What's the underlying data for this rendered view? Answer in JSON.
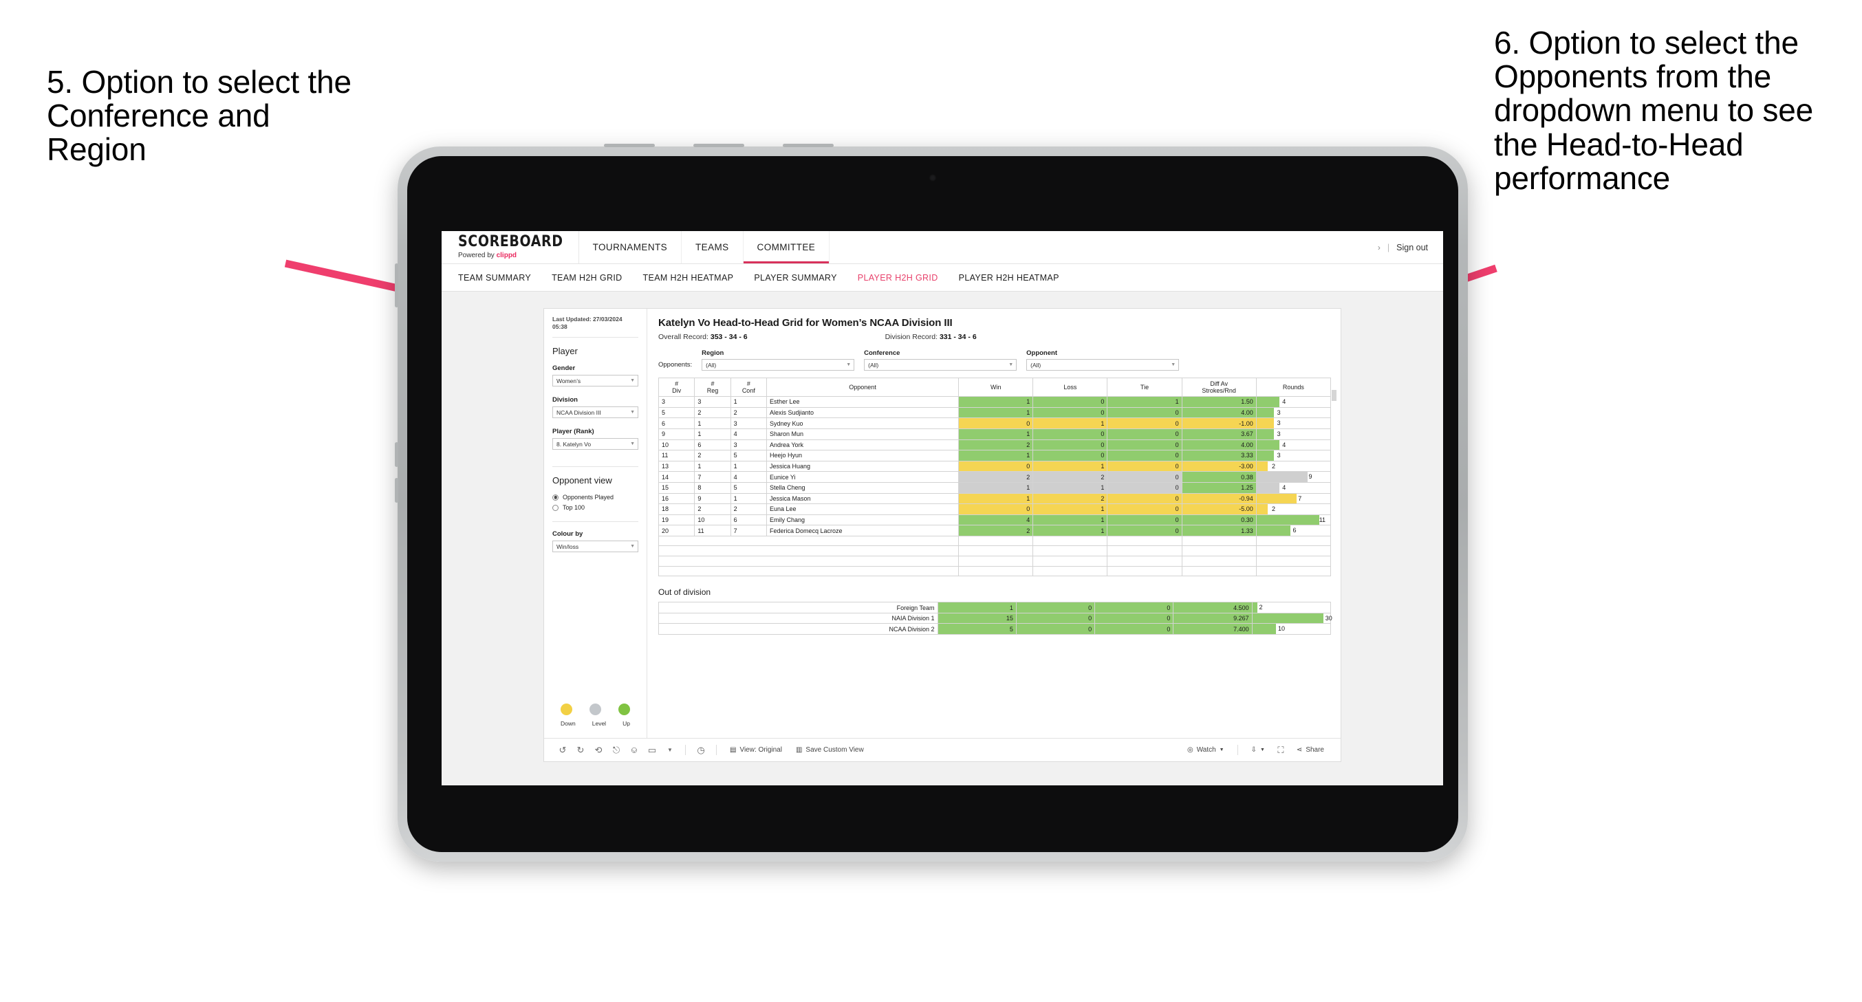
{
  "annotations": {
    "left": "5. Option to select the Conference and Region",
    "right": "6. Option to select the Opponents from the dropdown menu to see the Head-to-Head performance",
    "arrow_color": "#ef3e6d"
  },
  "app": {
    "brand": {
      "name": "SCOREBOARD",
      "powered_prefix": "Powered by",
      "powered_brand": "clippd"
    },
    "topnav": [
      {
        "label": "TOURNAMENTS",
        "active": false
      },
      {
        "label": "TEAMS",
        "active": false
      },
      {
        "label": "COMMITTEE",
        "active": true
      }
    ],
    "top_right": {
      "chevron": "›",
      "divider": "|",
      "sign_out": "Sign out"
    },
    "subnav": [
      {
        "label": "TEAM SUMMARY",
        "active": false
      },
      {
        "label": "TEAM H2H GRID",
        "active": false
      },
      {
        "label": "TEAM H2H HEATMAP",
        "active": false
      },
      {
        "label": "PLAYER SUMMARY",
        "active": false
      },
      {
        "label": "PLAYER H2H GRID",
        "active": true
      },
      {
        "label": "PLAYER H2H HEATMAP",
        "active": false
      }
    ]
  },
  "sidebar": {
    "last_updated": "Last Updated: 27/03/2024 05:38",
    "player_section": "Player",
    "gender": {
      "label": "Gender",
      "value": "Women’s"
    },
    "division": {
      "label": "Division",
      "value": "NCAA Division III"
    },
    "player_rank": {
      "label": "Player (Rank)",
      "value": "8. Katelyn Vo"
    },
    "opponent_view": {
      "title": "Opponent view",
      "options": [
        {
          "label": "Opponents Played",
          "selected": true
        },
        {
          "label": "Top 100",
          "selected": false
        }
      ]
    },
    "colour_by": {
      "label": "Colour by",
      "value": "Win/loss"
    },
    "legend": [
      {
        "label": "Down",
        "color": "#f2d044"
      },
      {
        "label": "Level",
        "color": "#c3c7cb"
      },
      {
        "label": "Up",
        "color": "#80c342"
      }
    ]
  },
  "main": {
    "title": "Katelyn Vo Head-to-Head Grid for Women’s NCAA Division III",
    "overall_record_label": "Overall Record:",
    "overall_record_value": "353 - 34 - 6",
    "division_record_label": "Division Record:",
    "division_record_value": "331 - 34 - 6",
    "opponents_label": "Opponents:",
    "filters": [
      {
        "label": "Region",
        "value": "(All)"
      },
      {
        "label": "Conference",
        "value": "(All)"
      },
      {
        "label": "Opponent",
        "value": "(All)"
      }
    ],
    "out_of_division_title": "Out of division"
  },
  "chart_data": {
    "type": "table",
    "title": "Katelyn Vo Head-to-Head Grid for Women’s NCAA Division III",
    "columns": [
      "# Div",
      "# Reg",
      "# Conf",
      "Opponent",
      "Win",
      "Loss",
      "Tie",
      "Diff Av Strokes/Rnd",
      "Rounds"
    ],
    "column_headers_multiline": [
      [
        "#",
        "Div"
      ],
      [
        "#",
        "Reg"
      ],
      [
        "#",
        "Conf"
      ],
      [
        "Opponent"
      ],
      [
        "Win"
      ],
      [
        "Loss"
      ],
      [
        "Tie"
      ],
      [
        "Diff Av",
        "Strokes/Rnd"
      ],
      [
        "Rounds"
      ]
    ],
    "rows": [
      {
        "div": "3",
        "reg": "3",
        "conf": "1",
        "opponent": "Esther Lee",
        "win": "1",
        "loss": "0",
        "tie": "1",
        "diff": "1.50",
        "rounds": 4,
        "result": "up"
      },
      {
        "div": "5",
        "reg": "2",
        "conf": "2",
        "opponent": "Alexis Sudjianto",
        "win": "1",
        "loss": "0",
        "tie": "0",
        "diff": "4.00",
        "rounds": 3,
        "result": "up"
      },
      {
        "div": "6",
        "reg": "1",
        "conf": "3",
        "opponent": "Sydney Kuo",
        "win": "0",
        "loss": "1",
        "tie": "0",
        "diff": "-1.00",
        "rounds": 3,
        "result": "down"
      },
      {
        "div": "9",
        "reg": "1",
        "conf": "4",
        "opponent": "Sharon Mun",
        "win": "1",
        "loss": "0",
        "tie": "0",
        "diff": "3.67",
        "rounds": 3,
        "result": "up"
      },
      {
        "div": "10",
        "reg": "6",
        "conf": "3",
        "opponent": "Andrea York",
        "win": "2",
        "loss": "0",
        "tie": "0",
        "diff": "4.00",
        "rounds": 4,
        "result": "up"
      },
      {
        "div": "11",
        "reg": "2",
        "conf": "5",
        "opponent": "Heejo Hyun",
        "win": "1",
        "loss": "0",
        "tie": "0",
        "diff": "3.33",
        "rounds": 3,
        "result": "up"
      },
      {
        "div": "13",
        "reg": "1",
        "conf": "1",
        "opponent": "Jessica Huang",
        "win": "0",
        "loss": "1",
        "tie": "0",
        "diff": "-3.00",
        "rounds": 2,
        "result": "down"
      },
      {
        "div": "14",
        "reg": "7",
        "conf": "4",
        "opponent": "Eunice Yi",
        "win": "2",
        "loss": "2",
        "tie": "0",
        "diff": "0.38",
        "rounds": 9,
        "result": "level",
        "diff_result": "up"
      },
      {
        "div": "15",
        "reg": "8",
        "conf": "5",
        "opponent": "Stella Cheng",
        "win": "1",
        "loss": "1",
        "tie": "0",
        "diff": "1.25",
        "rounds": 4,
        "result": "level",
        "diff_result": "up"
      },
      {
        "div": "16",
        "reg": "9",
        "conf": "1",
        "opponent": "Jessica Mason",
        "win": "1",
        "loss": "2",
        "tie": "0",
        "diff": "-0.94",
        "rounds": 7,
        "result": "down"
      },
      {
        "div": "18",
        "reg": "2",
        "conf": "2",
        "opponent": "Euna Lee",
        "win": "0",
        "loss": "1",
        "tie": "0",
        "diff": "-5.00",
        "rounds": 2,
        "result": "down"
      },
      {
        "div": "19",
        "reg": "10",
        "conf": "6",
        "opponent": "Emily Chang",
        "win": "4",
        "loss": "1",
        "tie": "0",
        "diff": "0.30",
        "rounds": 11,
        "result": "up"
      },
      {
        "div": "20",
        "reg": "11",
        "conf": "7",
        "opponent": "Federica Domecq Lacroze",
        "win": "2",
        "loss": "1",
        "tie": "0",
        "diff": "1.33",
        "rounds": 6,
        "result": "up"
      }
    ],
    "rounds_max": 13,
    "out_of_division": [
      {
        "name": "Foreign Team",
        "win": "1",
        "loss": "0",
        "tie": "0",
        "diff": "4.500",
        "rounds": 2,
        "result": "up"
      },
      {
        "name": "NAIA Division 1",
        "win": "15",
        "loss": "0",
        "tie": "0",
        "diff": "9.267",
        "rounds": 30,
        "result": "up"
      },
      {
        "name": "NCAA Division 2",
        "win": "5",
        "loss": "0",
        "tie": "0",
        "diff": "7.400",
        "rounds": 10,
        "result": "up"
      }
    ],
    "ood_rounds_max": 33,
    "colors": {
      "up": "#90cc6e",
      "down": "#f5d553",
      "level": "#cfcfcf"
    }
  },
  "toolbar": {
    "icons": [
      "undo-icon",
      "redo-icon",
      "revert-icon",
      "refresh-icon",
      "pause-icon",
      "zoom-icon",
      "dropdown-icon",
      "clock-icon"
    ],
    "view_original": "View: Original",
    "save_custom_view": "Save Custom View",
    "watch": "Watch",
    "share": "Share"
  }
}
